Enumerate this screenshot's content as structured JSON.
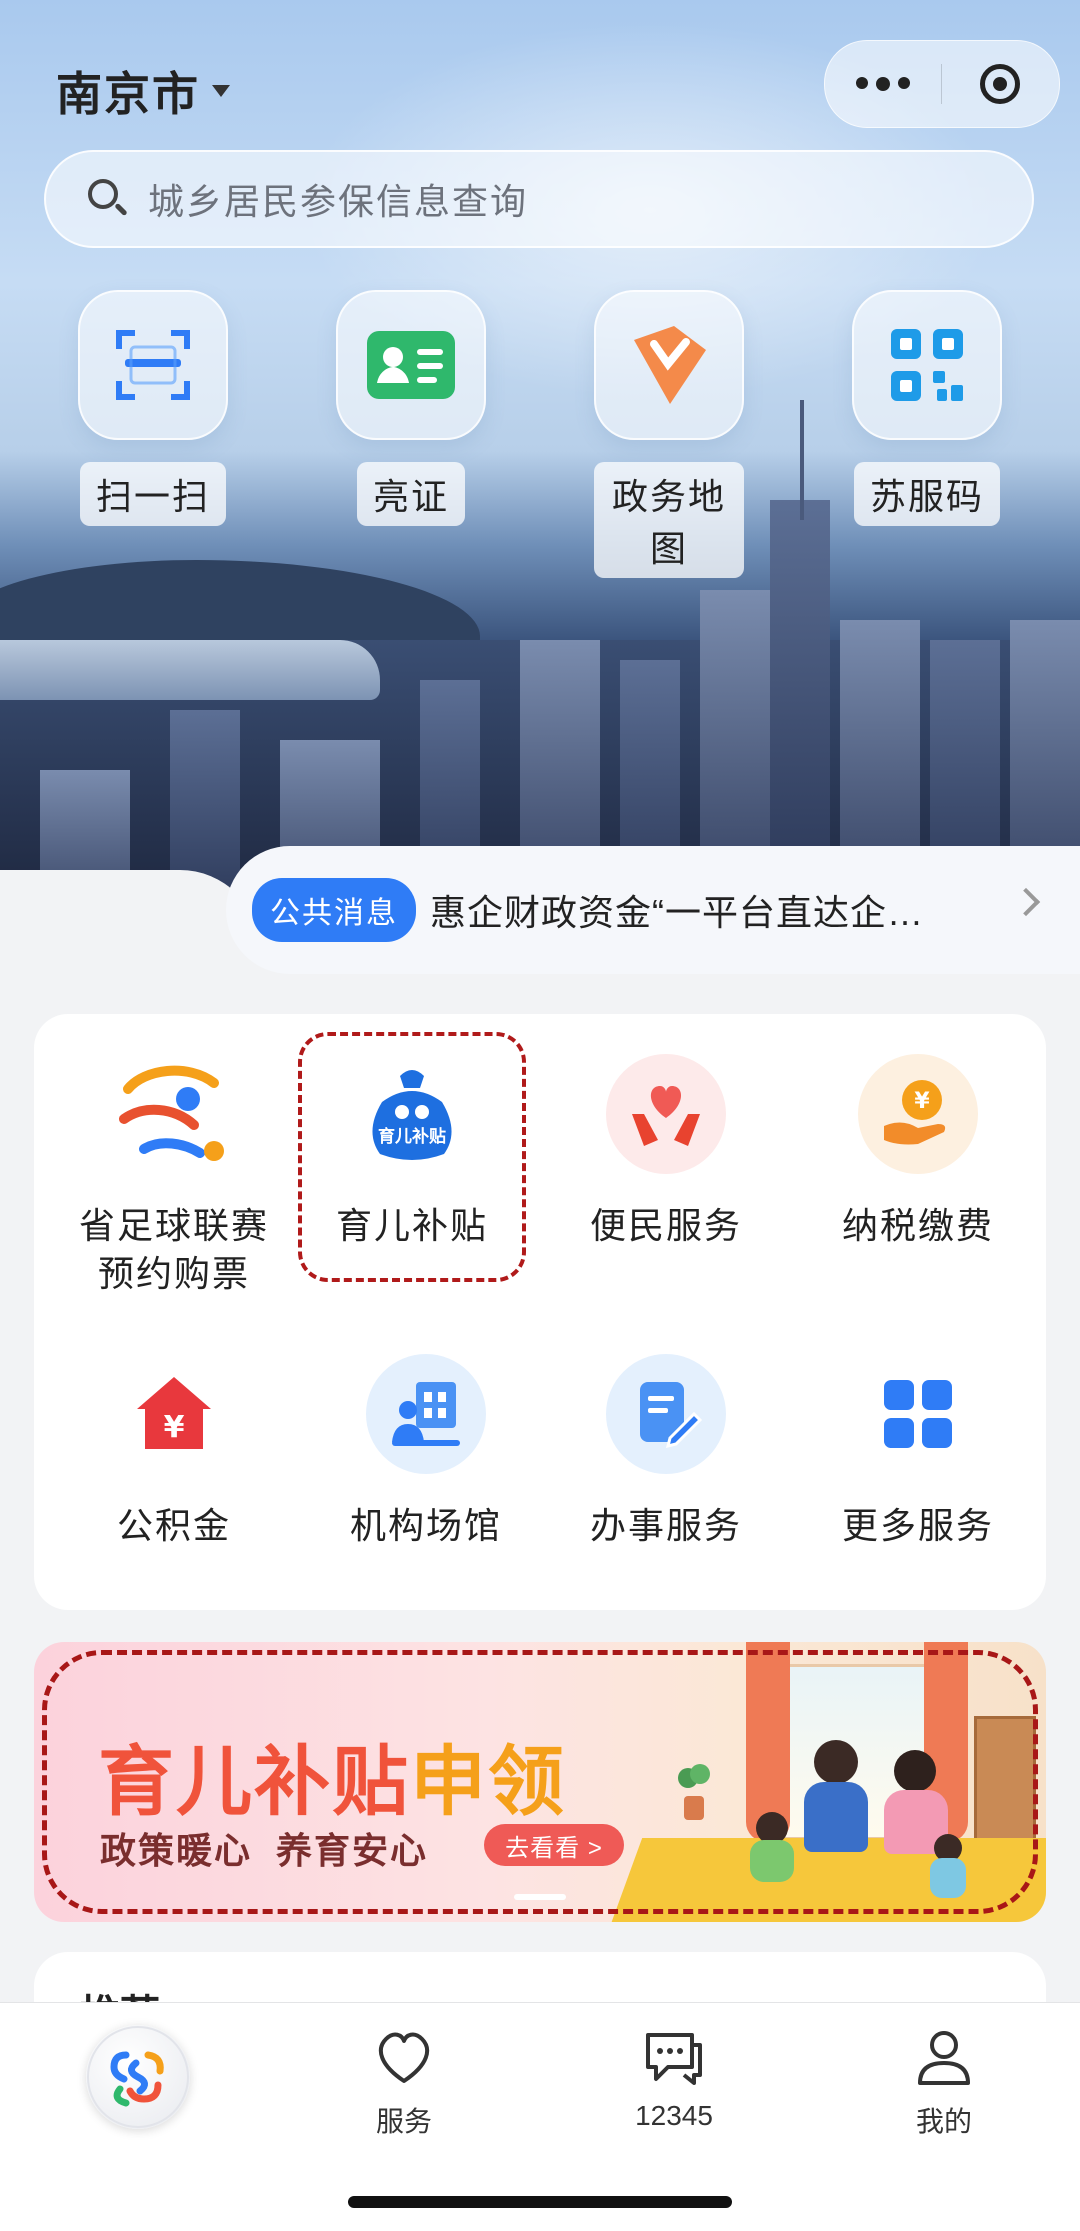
{
  "header": {
    "city": "南京市",
    "search_placeholder": "城乡居民参保信息查询"
  },
  "quick_actions": [
    {
      "label": "扫一扫",
      "icon": "scan-icon"
    },
    {
      "label": "亮证",
      "icon": "id-card-icon"
    },
    {
      "label": "政务地图",
      "icon": "map-pin-icon"
    },
    {
      "label": "苏服码",
      "icon": "qr-code-icon"
    }
  ],
  "notice": {
    "badge": "公共消息",
    "text": "惠企财政资金“一平台直达企…"
  },
  "services": [
    {
      "label": "省足球联赛\n预约购票",
      "line1": "省足球联赛",
      "line2": "预约购票",
      "icon": "football-league-icon"
    },
    {
      "label": "育儿补贴",
      "icon": "childcare-subsidy-bag-icon",
      "icon_text": "育儿补贴"
    },
    {
      "label": "便民服务",
      "icon": "heart-hands-icon"
    },
    {
      "label": "纳税缴费",
      "icon": "coin-hand-icon"
    },
    {
      "label": "公积金",
      "icon": "house-yuan-icon"
    },
    {
      "label": "机构场馆",
      "icon": "building-icon"
    },
    {
      "label": "办事服务",
      "icon": "document-edit-icon"
    },
    {
      "label": "更多服务",
      "icon": "grid-icon"
    }
  ],
  "banner": {
    "title_part1": "育儿补贴",
    "title_part2": "申领",
    "subtitle": "政策暖心  养育安心",
    "button": "去看看 >"
  },
  "section_peek": "推荐",
  "tabbar": {
    "items": [
      {
        "label": "",
        "icon": "app-logo-icon"
      },
      {
        "label": "服务",
        "icon": "heart-icon"
      },
      {
        "label": "12345",
        "icon": "chat-icon"
      },
      {
        "label": "我的",
        "icon": "user-icon"
      }
    ]
  },
  "colors": {
    "accent": "#2f7cf6",
    "highlight_dash": "#b01a1a",
    "banner_red": "#f0533b",
    "banner_orange": "#f5a01a"
  }
}
